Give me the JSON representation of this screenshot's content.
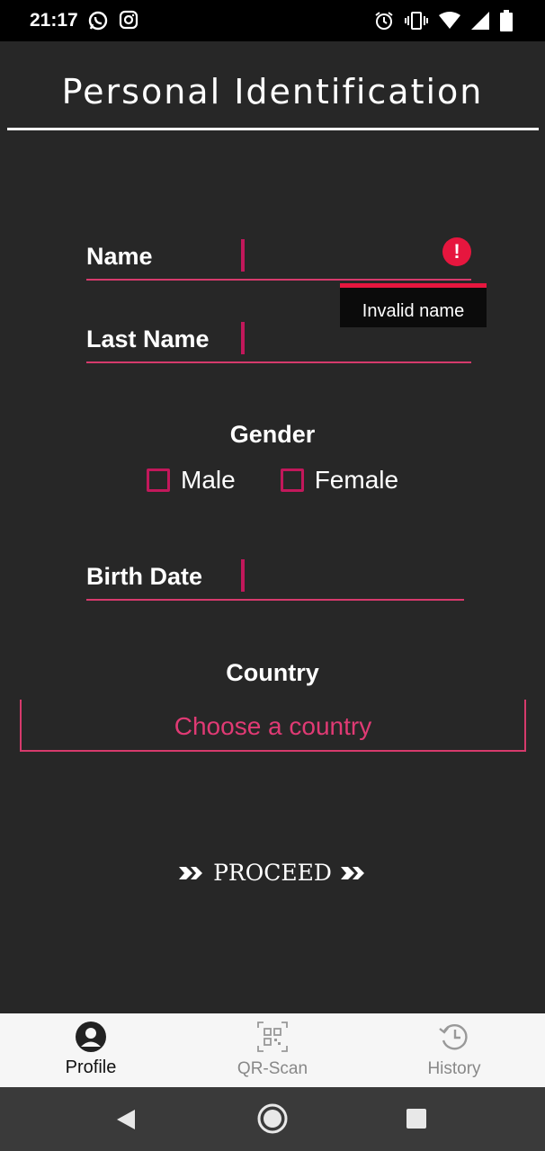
{
  "status": {
    "time": "21:17"
  },
  "header": {
    "title": "Personal Identification"
  },
  "form": {
    "name_label": "Name",
    "name_value": "",
    "name_error": "Invalid name",
    "last_name_label": "Last Name",
    "last_name_value": "",
    "gender_title": "Gender",
    "gender_options": [
      "Male",
      "Female"
    ],
    "birth_date_label": "Birth Date",
    "birth_date_value": "",
    "country_title": "Country",
    "country_placeholder": "Choose a country",
    "proceed_label": "PROCEED"
  },
  "nav": {
    "items": [
      {
        "label": "Profile",
        "icon": "profile-icon",
        "active": true
      },
      {
        "label": "QR-Scan",
        "icon": "qr-icon",
        "active": false
      },
      {
        "label": "History",
        "icon": "history-icon",
        "active": false
      }
    ]
  },
  "colors": {
    "accent": "#d63a6c",
    "error": "#e6163e",
    "background": "#272727"
  }
}
